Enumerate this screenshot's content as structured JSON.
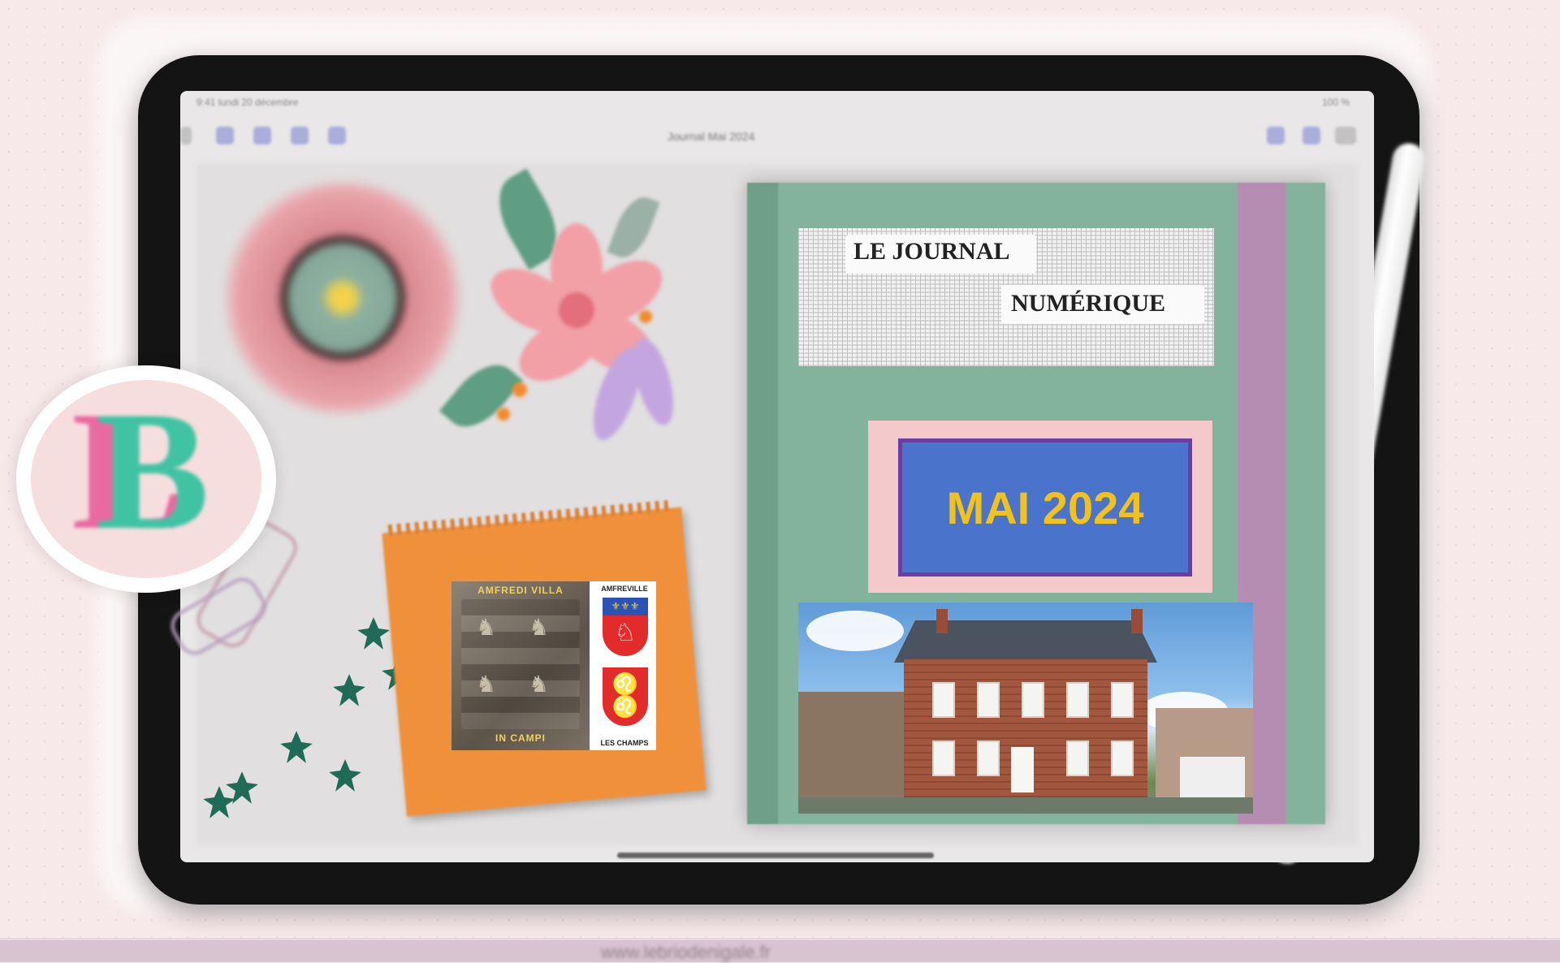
{
  "screen": {
    "status_left": "9:41 lundi 20 décembre",
    "status_right": "100 %",
    "doc_title": "Journal Mai 2024"
  },
  "logo": {
    "letter1": "L",
    "letter2": "B"
  },
  "emblem": {
    "left_top": "AMFREDI VILLA",
    "left_bottom": "IN CAMPI",
    "right_top": "AMFREVILLE",
    "right_bottom": "LES CHAMPS"
  },
  "journal": {
    "header_line1": "LE JOURNAL",
    "header_line2": "NUMÉRIQUE",
    "issue": "MAI 2024"
  },
  "footer": {
    "url": "www.lebriodenigale.fr"
  },
  "colors": {
    "issue_text": "#f2c21b",
    "issue_box": "#4a73cc",
    "journal_cover": "#83b39c"
  }
}
